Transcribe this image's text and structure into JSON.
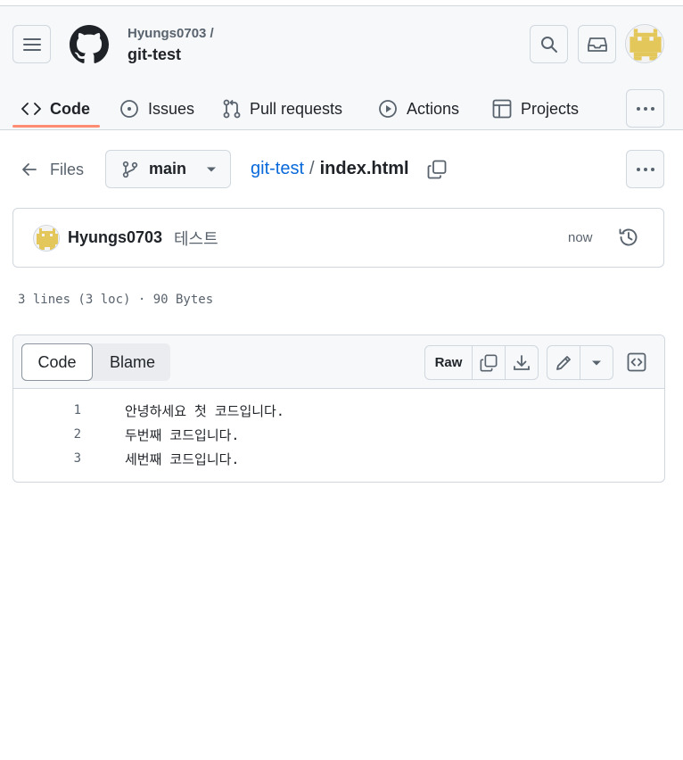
{
  "header": {
    "owner": "Hyungs0703 /",
    "repo": "git-test"
  },
  "tabs": [
    {
      "label": "Code",
      "icon": "code-icon",
      "active": true
    },
    {
      "label": "Issues",
      "icon": "issue-icon",
      "active": false
    },
    {
      "label": "Pull requests",
      "icon": "pull-request-icon",
      "active": false
    },
    {
      "label": "Actions",
      "icon": "play-icon",
      "active": false
    },
    {
      "label": "Projects",
      "icon": "table-icon",
      "active": false
    }
  ],
  "filebar": {
    "files_label": "Files",
    "branch": "main",
    "breadcrumb_repo": "git-test",
    "breadcrumb_sep": "/",
    "breadcrumb_file": "index.html"
  },
  "commit": {
    "author": "Hyungs0703",
    "message": "테스트",
    "time": "now"
  },
  "file_info": "3 lines (3 loc) · 90 Bytes",
  "code_view": {
    "tab_code": "Code",
    "tab_blame": "Blame",
    "raw_label": "Raw"
  },
  "lines": [
    {
      "num": "1",
      "text": "안녕하세요 첫 코드입니다."
    },
    {
      "num": "2",
      "text": "두번째 코드입니다."
    },
    {
      "num": "3",
      "text": "세번째 코드입니다."
    }
  ],
  "colors": {
    "accent_link": "#0969da",
    "tab_underline": "#fd8c73",
    "avatar_yellow": "#e3c75b"
  }
}
